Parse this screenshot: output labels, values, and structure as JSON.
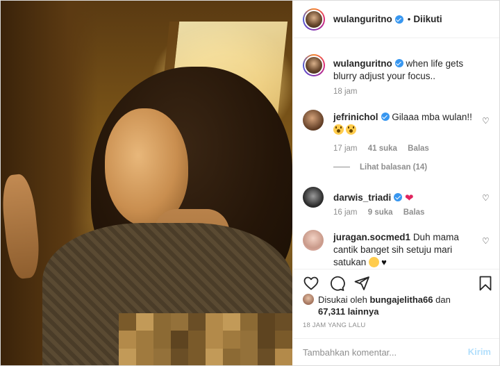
{
  "post": {
    "author": "wulanguritno",
    "follow_status": "Diikuti",
    "separator": "•"
  },
  "caption": {
    "username": "wulanguritno",
    "text": "when life gets blurry adjust your focus..",
    "time": "18 jam"
  },
  "comments": [
    {
      "username": "jefrinichol",
      "text": "Gilaaa mba wulan!!",
      "time": "17 jam",
      "likes": "41 suka",
      "reply": "Balas",
      "view_replies": "Lihat balasan (14)"
    },
    {
      "username": "darwis_triadi",
      "text": "",
      "time": "16 jam",
      "likes": "9 suka",
      "reply": "Balas"
    },
    {
      "username": "juragan.socmed1",
      "text": "Duh mama cantik banget sih setuju mari satukan"
    }
  ],
  "likes_summary": {
    "prefix": "Disukai oleh",
    "user": "bungajelitha66",
    "joiner": "dan",
    "count": "67,311 lainnya"
  },
  "timestamp": "18 JAM YANG LALU",
  "comment_box": {
    "placeholder": "Tambahkan komentar...",
    "submit": "Kirim"
  },
  "colors": {
    "verified": "#3897f0",
    "muted": "#8e8e8e",
    "submit_disabled": "#b2dffc",
    "heart_red": "#e0245e"
  },
  "icons": [
    "heart-icon",
    "comment-icon",
    "share-icon",
    "bookmark-icon",
    "verified-icon"
  ]
}
